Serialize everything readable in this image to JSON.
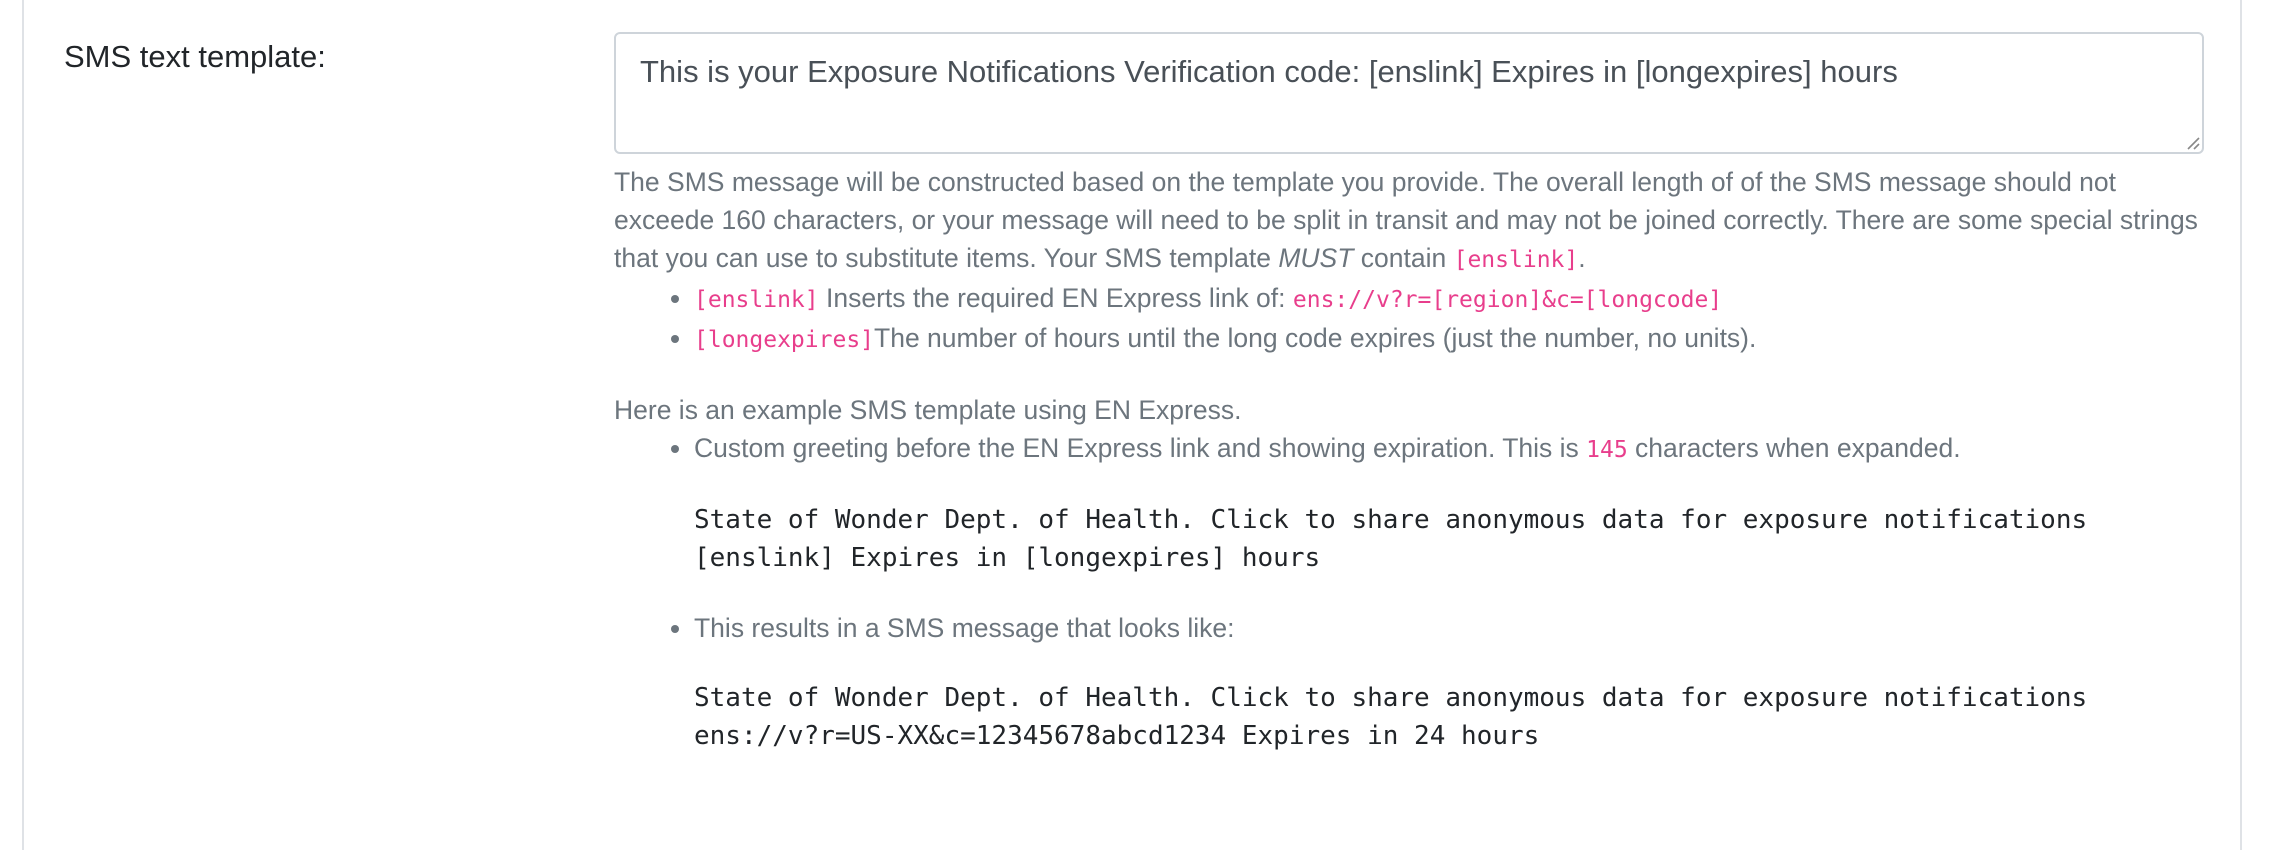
{
  "field": {
    "label": "SMS text template:",
    "value": "This is your Exposure Notifications Verification code: [enslink] Expires in [longexpires] hours"
  },
  "help": {
    "intro_part1": "The SMS message will be constructed based on the template you provide. The overall length of of the SMS message should not exceede 160 characters, or your message will need to be split in transit and may not be joined correctly. There are some special strings that you can use to substitute items. Your SMS template ",
    "intro_must": "MUST",
    "intro_contain": " contain ",
    "intro_code": "[enslink]",
    "intro_end": ".",
    "items": [
      {
        "code": "[enslink]",
        "text": " Inserts the required EN Express link of: ",
        "code2": "ens://v?r=[region]&c=[longcode]"
      },
      {
        "code": "[longexpires]",
        "text": "The number of hours until the long code expires (just the number, no units)."
      }
    ],
    "example_intro": "Here is an example SMS template using EN Express.",
    "example_item1_before": "Custom greeting before the EN Express link and showing expiration. This is ",
    "example_item1_count": "145",
    "example_item1_after": " characters when expanded.",
    "example_template": "State of Wonder Dept. of Health. Click to share anonymous data for exposure notifications\n[enslink] Expires in [longexpires] hours",
    "example_item2": "This results in a SMS message that looks like:",
    "example_result": "State of Wonder Dept. of Health. Click to share anonymous data for exposure notifications\nens://v?r=US-XX&c=12345678abcd1234 Expires in 24 hours"
  }
}
